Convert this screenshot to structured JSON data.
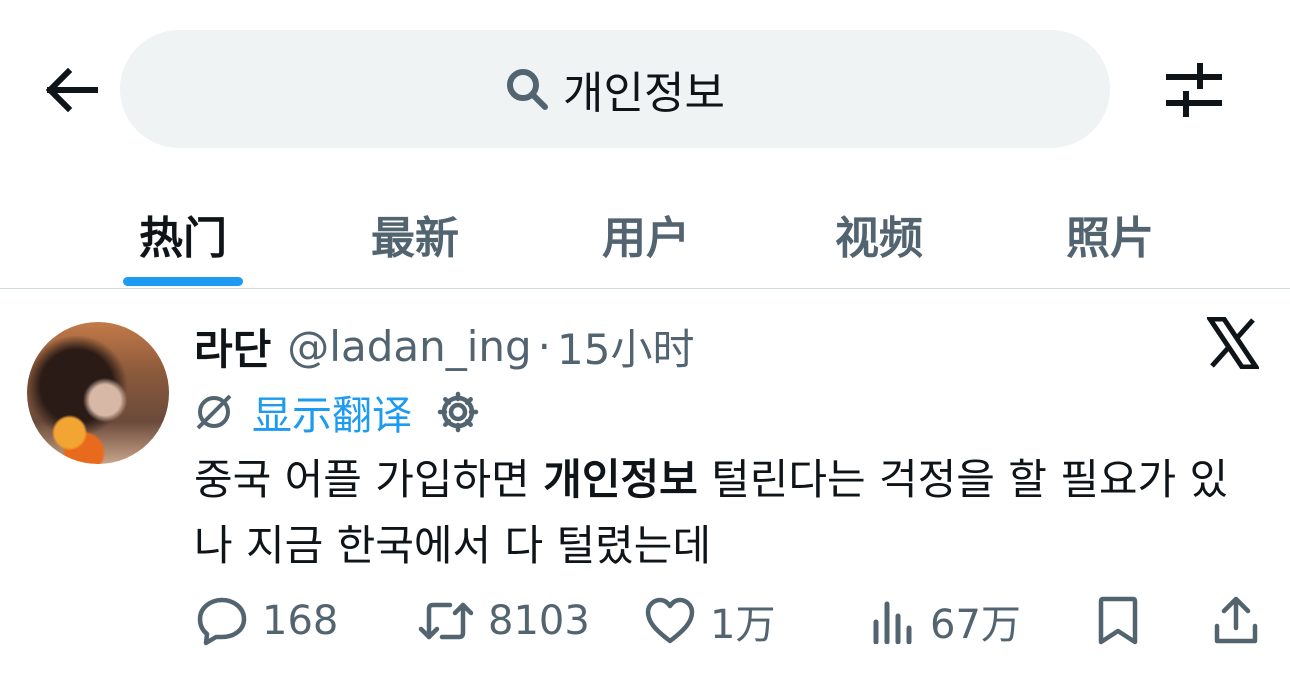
{
  "search": {
    "query": "개인정보"
  },
  "tabs": [
    {
      "label": "热门",
      "active": true
    },
    {
      "label": "最新",
      "active": false
    },
    {
      "label": "用户",
      "active": false
    },
    {
      "label": "视频",
      "active": false
    },
    {
      "label": "照片",
      "active": false
    }
  ],
  "tweet": {
    "display_name": "라단",
    "handle": "@ladan_ing",
    "separator": "·",
    "time": "15小时",
    "translate_label": "显示翻译",
    "text_before": "중국 어플 가입하면 ",
    "text_highlight": "개인정보",
    "text_after": " 털린다는 걱정을 할 필요가 있나 지금 한국에서 다 털렸는데",
    "stats": {
      "replies": "168",
      "reposts": "8103",
      "likes": "1万",
      "views": "67万"
    }
  },
  "colors": {
    "accent": "#1d9bf0",
    "search_bg": "#eff3f4",
    "secondary_text": "#536471",
    "primary_text": "#0f1419"
  },
  "icons": [
    "back-arrow-icon",
    "search-icon",
    "filter-sliders-icon",
    "x-logo-icon",
    "translate-globe-icon",
    "gear-icon",
    "reply-icon",
    "repost-icon",
    "like-icon",
    "views-icon",
    "bookmark-icon",
    "share-icon"
  ]
}
